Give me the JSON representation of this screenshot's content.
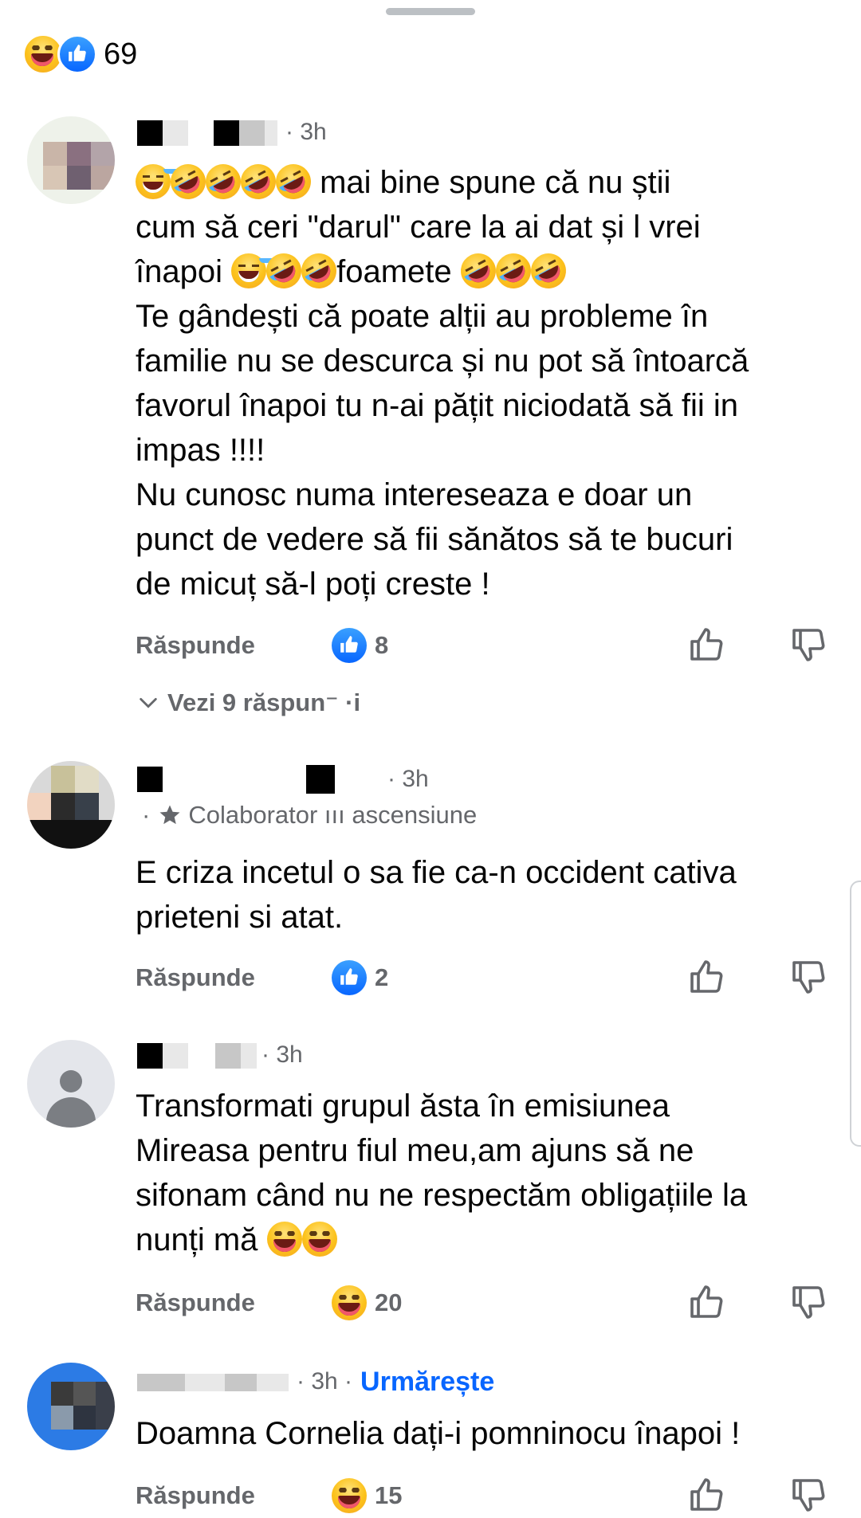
{
  "summary": {
    "count": "69",
    "reactions": [
      "haha-icon",
      "like-icon"
    ]
  },
  "comments": [
    {
      "time": "· 3h",
      "lines": [
        {
          "segments": [
            [
              "emoji",
              "sweat"
            ],
            [
              "emoji",
              "rofl"
            ],
            [
              "emoji",
              "rofl"
            ],
            [
              "emoji",
              "rofl"
            ],
            [
              "emoji",
              "rofl"
            ],
            [
              "text",
              " mai bine spune că nu știi"
            ]
          ]
        },
        {
          "segments": [
            [
              "text",
              "cum să ceri \"darul\" care la ai dat și l vrei"
            ]
          ]
        },
        {
          "segments": [
            [
              "text",
              "înapoi "
            ],
            [
              "emoji",
              "sweat"
            ],
            [
              "emoji",
              "rofl"
            ],
            [
              "emoji",
              "rofl"
            ],
            [
              "text",
              "foamete "
            ],
            [
              "emoji",
              "rofl"
            ],
            [
              "emoji",
              "rofl"
            ],
            [
              "emoji",
              "rofl"
            ]
          ]
        },
        {
          "segments": [
            [
              "text",
              "Te gândești că poate alții au probleme în"
            ]
          ]
        },
        {
          "segments": [
            [
              "text",
              "familie nu se descurca și nu pot să întoarcă"
            ]
          ]
        },
        {
          "segments": [
            [
              "text",
              "favorul înapoi tu n-ai pățit niciodată să fii in"
            ]
          ]
        },
        {
          "segments": [
            [
              "text",
              "impas !!!!"
            ]
          ]
        },
        {
          "segments": [
            [
              "text",
              "Nu cunosc numa intereseaza e doar un"
            ]
          ]
        },
        {
          "segments": [
            [
              "text",
              "punct de vedere să fii sănătos să te bucuri"
            ]
          ]
        },
        {
          "segments": [
            [
              "text",
              "de micuț să-l poți creste !"
            ]
          ]
        }
      ],
      "reply_label": "Răspunde",
      "reaction": "like",
      "reaction_count": "8",
      "view_replies": "Vezi 9 răspun⁻ ·i"
    },
    {
      "time": "· 3h",
      "badge": "Colaborator ııı ascensiune",
      "text": "E criza incetul o sa fie ca-n occident cativa\nprieteni si atat.",
      "reply_label": "Răspunde",
      "reaction": "like",
      "reaction_count": "2"
    },
    {
      "time": "· 3h",
      "lines": [
        {
          "segments": [
            [
              "text",
              "Transformati grupul ăsta în emisiunea"
            ]
          ]
        },
        {
          "segments": [
            [
              "text",
              "Mireasa pentru fiul meu,am ajuns să ne"
            ]
          ]
        },
        {
          "segments": [
            [
              "text",
              "sifonam când nu ne respectăm obligațiile la"
            ]
          ]
        },
        {
          "segments": [
            [
              "text",
              "nunți mă "
            ],
            [
              "emoji",
              "haha"
            ],
            [
              "emoji",
              "haha"
            ]
          ]
        }
      ],
      "reply_label": "Răspunde",
      "reaction": "haha",
      "reaction_count": "20"
    },
    {
      "time": "· 3h ·",
      "follow": "Urmărește",
      "text": "Doamna Cornelia dați-i pomninocu înapoi !",
      "reply_label": "Răspunde",
      "reaction": "haha",
      "reaction_count": "15"
    }
  ]
}
